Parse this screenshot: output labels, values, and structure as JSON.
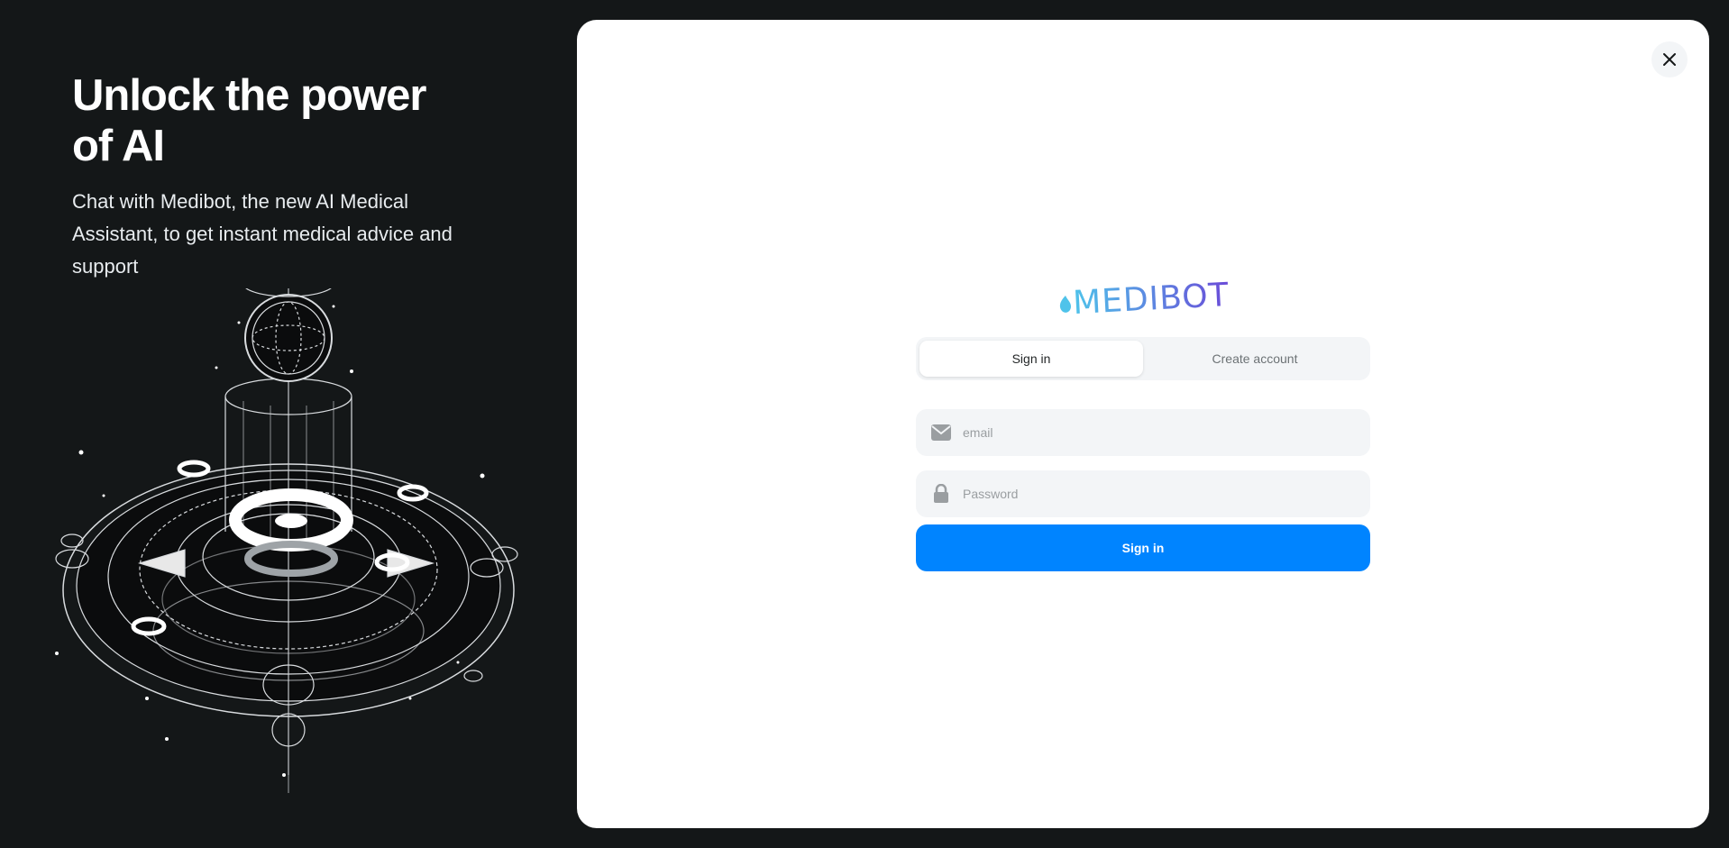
{
  "hero": {
    "title": "Unlock the power of AI",
    "subtitle": "Chat with Medibot, the new AI Medical Assistant, to get instant medical advice and support"
  },
  "modal": {
    "close_icon": "close-icon",
    "logo_text": "MEDIBOT",
    "tabs": [
      {
        "label": "Sign in",
        "active": true
      },
      {
        "label": "Create account",
        "active": false
      }
    ],
    "email": {
      "icon": "envelope-icon",
      "placeholder": "email",
      "value": ""
    },
    "password": {
      "icon": "lock-icon",
      "placeholder": "Password",
      "value": ""
    },
    "submit_label": "Sign in"
  },
  "colors": {
    "background": "#141718",
    "primary": "#0084ff",
    "logo_start": "#4fc3ea",
    "logo_end": "#6a4bd8"
  }
}
